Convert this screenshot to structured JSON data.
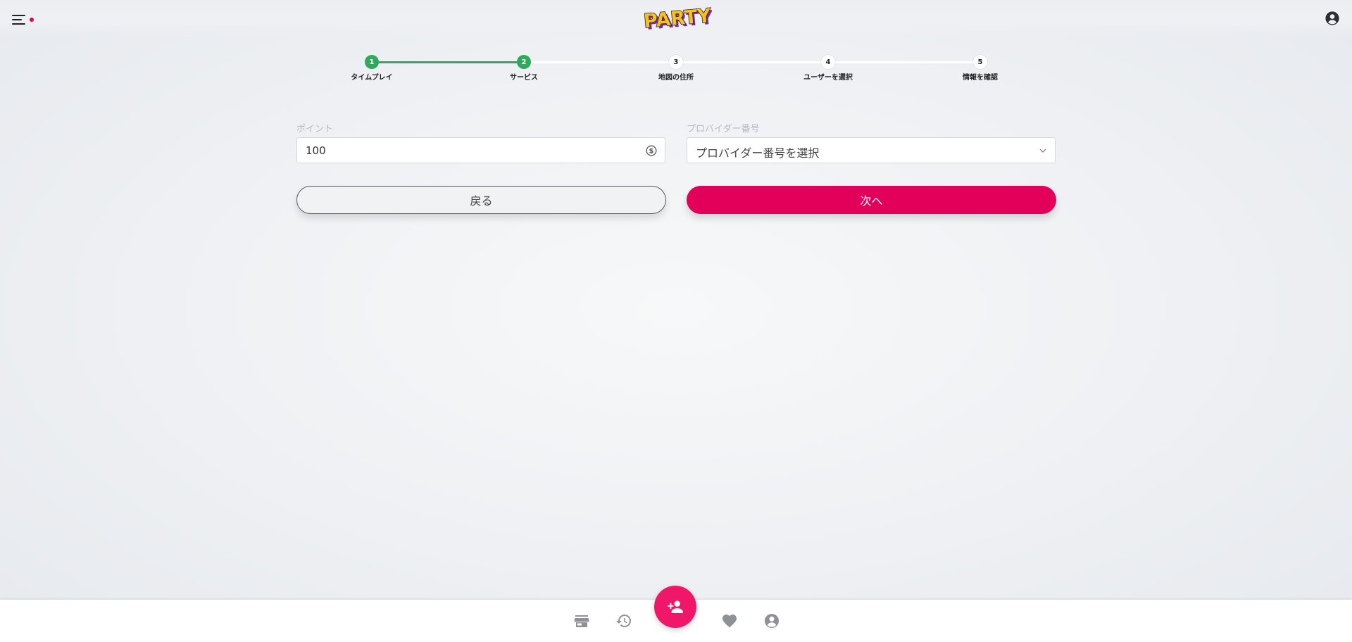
{
  "header": {
    "logo_text": "PARTY",
    "icons": {
      "menu": "menu-icon",
      "notification": "notification-dot",
      "account": "account-circle-icon"
    }
  },
  "stepper": {
    "steps": [
      {
        "number": "1",
        "label": "タイムプレイ",
        "status": "done"
      },
      {
        "number": "2",
        "label": "サービス",
        "status": "current"
      },
      {
        "number": "3",
        "label": "地図の住所",
        "status": "todo"
      },
      {
        "number": "4",
        "label": "ユーザーを選択",
        "status": "todo"
      },
      {
        "number": "5",
        "label": "情報を確認",
        "status": "todo"
      }
    ],
    "completed_color": "#2eaa5c"
  },
  "form": {
    "points": {
      "label": "ポイント",
      "value": "100",
      "icon": "dollar-coin-icon"
    },
    "provider": {
      "label": "プロバイダー番号",
      "placeholder": "プロバイダー番号を選択",
      "icon": "chevron-down-icon"
    },
    "back_label": "戻る",
    "next_label": "次へ"
  },
  "bottom_nav": {
    "items": [
      "store-icon",
      "history-icon",
      "add-person-icon",
      "heart-icon",
      "account-circle-icon"
    ]
  },
  "colors": {
    "accent": "#e2005a",
    "fab": "#f0176b",
    "success": "#2eaa5c",
    "background": "#eef0f3"
  }
}
